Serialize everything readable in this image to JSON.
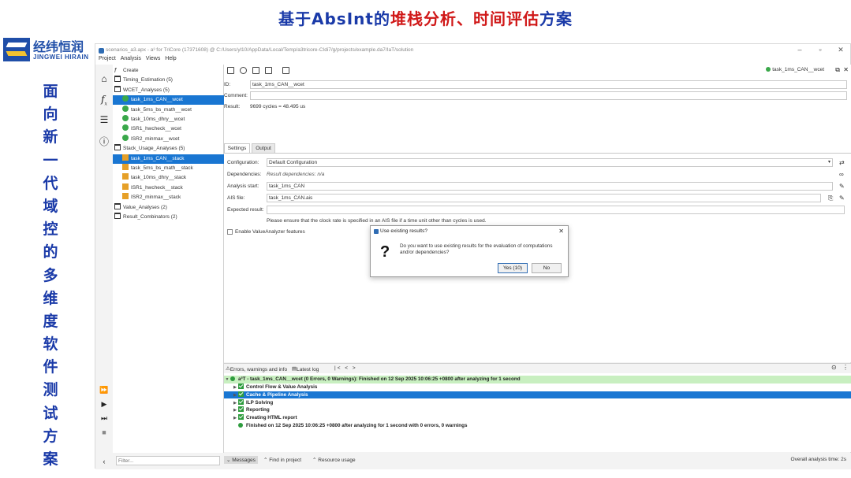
{
  "slide": {
    "title_part1": "基于AbsInt的",
    "title_part2": "堆栈分析、时间评估",
    "title_part3": "方案",
    "side_title_chars": [
      "面",
      "向",
      "新",
      "一",
      "代",
      "域",
      "控",
      "的",
      "多",
      "维",
      "度",
      "软",
      "件",
      "测",
      "试",
      "方",
      "案"
    ]
  },
  "logo": {
    "cn": "经纬恒润",
    "en": "JINGWEI HIRAIN",
    "colors": {
      "primary": "#1f4ea8",
      "accent": "#f2c230"
    }
  },
  "window": {
    "title": "scenarios_a3.apx - a³ for TriCore (17371608) @ C:/Users/yl10/AppData/Local/Temp/a3tricore-CIdi7/g/projects/example.da7/IaT/solution",
    "controls": [
      "–",
      "▫",
      "✕"
    ]
  },
  "menu": [
    "Project",
    "Analysis",
    "Views",
    "Help"
  ],
  "tree": [
    {
      "label": "Create",
      "icon": "fx-icon",
      "indent": 0
    },
    {
      "label": "Timing_Estimation (5)",
      "icon": "folder-icon",
      "indent": 0
    },
    {
      "label": "WCET_Analyses (5)",
      "icon": "folder-icon",
      "indent": 0
    },
    {
      "label": "task_1ms_CAN__wcet",
      "icon": "clock-icon",
      "indent": 1,
      "selected": true
    },
    {
      "label": "task_5ms_bs_math__wcet",
      "icon": "clock-icon",
      "indent": 1
    },
    {
      "label": "task_10ms_dhry__wcet",
      "icon": "clock-icon",
      "indent": 1
    },
    {
      "label": "ISR1_hwcheck__wcet",
      "icon": "clock-icon",
      "indent": 1
    },
    {
      "label": "ISR2_minmax__wcet",
      "icon": "clock-icon",
      "indent": 1
    },
    {
      "label": "Stack_Usage_Analyses (5)",
      "icon": "folder-icon",
      "indent": 0
    },
    {
      "label": "task_1ms_CAN__stack",
      "icon": "stack-icon",
      "indent": 1,
      "selected": true
    },
    {
      "label": "task_5ms_bs_math__stack",
      "icon": "stack-icon",
      "indent": 1
    },
    {
      "label": "task_10ms_dhry__stack",
      "icon": "stack-icon",
      "indent": 1
    },
    {
      "label": "ISR1_hwcheck__stack",
      "icon": "stack-icon",
      "indent": 1
    },
    {
      "label": "ISR2_minmax__stack",
      "icon": "stack-icon",
      "indent": 1
    },
    {
      "label": "Value_Analyses (2)",
      "icon": "folder-icon",
      "indent": 0
    },
    {
      "label": "Result_Combinators (2)",
      "icon": "folder-icon",
      "indent": 0
    }
  ],
  "filter": {
    "placeholder": "Filter..."
  },
  "main": {
    "task_label": "task_1ms_CAN__wcet",
    "id_label": "ID:",
    "id_value": "task_1ms_CAN__wcet",
    "comment_label": "Comment:",
    "comment_value": "",
    "result_label": "Result:",
    "result_value": "9699 cycles = 48.495 us",
    "tabs": [
      "Settings",
      "Output"
    ],
    "settings": {
      "configuration_label": "Configuration:",
      "configuration_value": "Default Configuration",
      "dependencies_label": "Dependencies:",
      "dependencies_value": "Result dependencies: n/a",
      "analysis_start_label": "Analysis start:",
      "analysis_start_value": "task_1ms_CAN",
      "ais_file_label": "AIS file:",
      "ais_file_value": "task_1ms_CAN.ais",
      "expected_result_label": "Expected result:",
      "expected_result_value": "",
      "note": "Please ensure that the clock rate is specified in an AIS file if a time unit other than cycles is used.",
      "checkbox_label": "Enable ValueAnalyzer features"
    }
  },
  "dialog": {
    "title": "Use existing results?",
    "message": "Do you want to use existing results for the evaluation of computations and/or dependencies?",
    "yes_label": "Yes (10)",
    "no_label": "No"
  },
  "log": {
    "tabs": [
      "Errors, warnings and info",
      "Latest log"
    ],
    "nav": "|<  <  >",
    "header": "a³T - task_1ms_CAN__wcet (0 Errors, 0 Warnings): Finished on 12 Sep 2025 10:06:25 +0800 after analyzing for 1 second",
    "items": [
      {
        "label": "Control Flow & Value Analysis"
      },
      {
        "label": "Cache & Pipeline Analysis",
        "selected": true
      },
      {
        "label": "ILP Solving"
      },
      {
        "label": "Reporting"
      },
      {
        "label": "Creating HTML report"
      }
    ],
    "footer": "Finished on 12 Sep 2025 10:06:25 +0800 after analyzing for 1 second with 0 errors, 0 warnings"
  },
  "statusbar": {
    "messages": "Messages",
    "find": "Find in project",
    "resource": "Resource usage",
    "overall": "Overall analysis time: 2s"
  }
}
